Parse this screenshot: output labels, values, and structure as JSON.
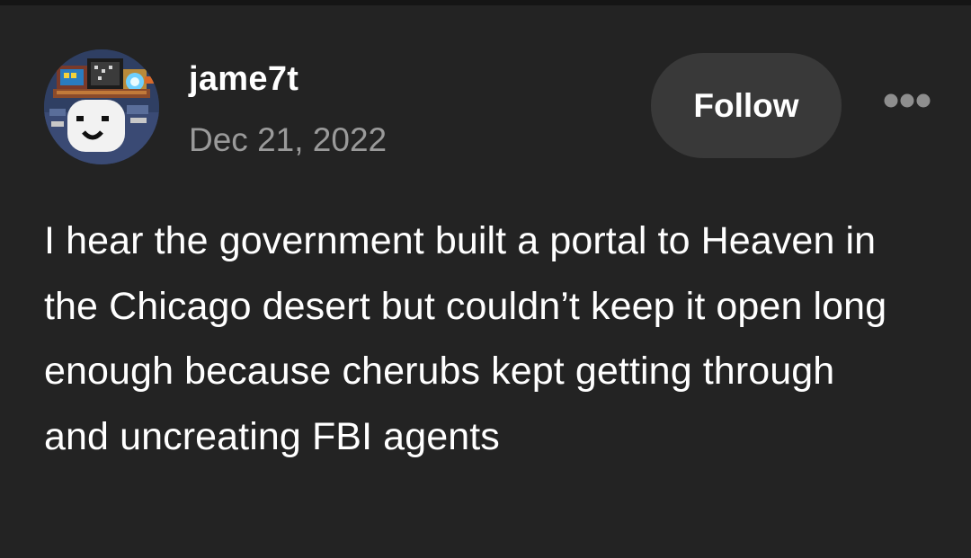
{
  "post": {
    "author": {
      "username": "jame7t",
      "avatar_icon": "pixel-art-avatar-icon"
    },
    "date": "Dec 21, 2022",
    "follow_label": "Follow",
    "more_icon": "ellipsis-icon",
    "body": "I hear the government built a portal to Heaven in the Chicago desert but couldn’t keep it open long enough because cherubs kept getting through and uncreating FBI agents"
  },
  "colors": {
    "background": "#232323",
    "text_primary": "#ffffff",
    "text_secondary": "#9a9a9a",
    "follow_button_bg": "#393939",
    "more_dots": "#8e8e8e"
  }
}
